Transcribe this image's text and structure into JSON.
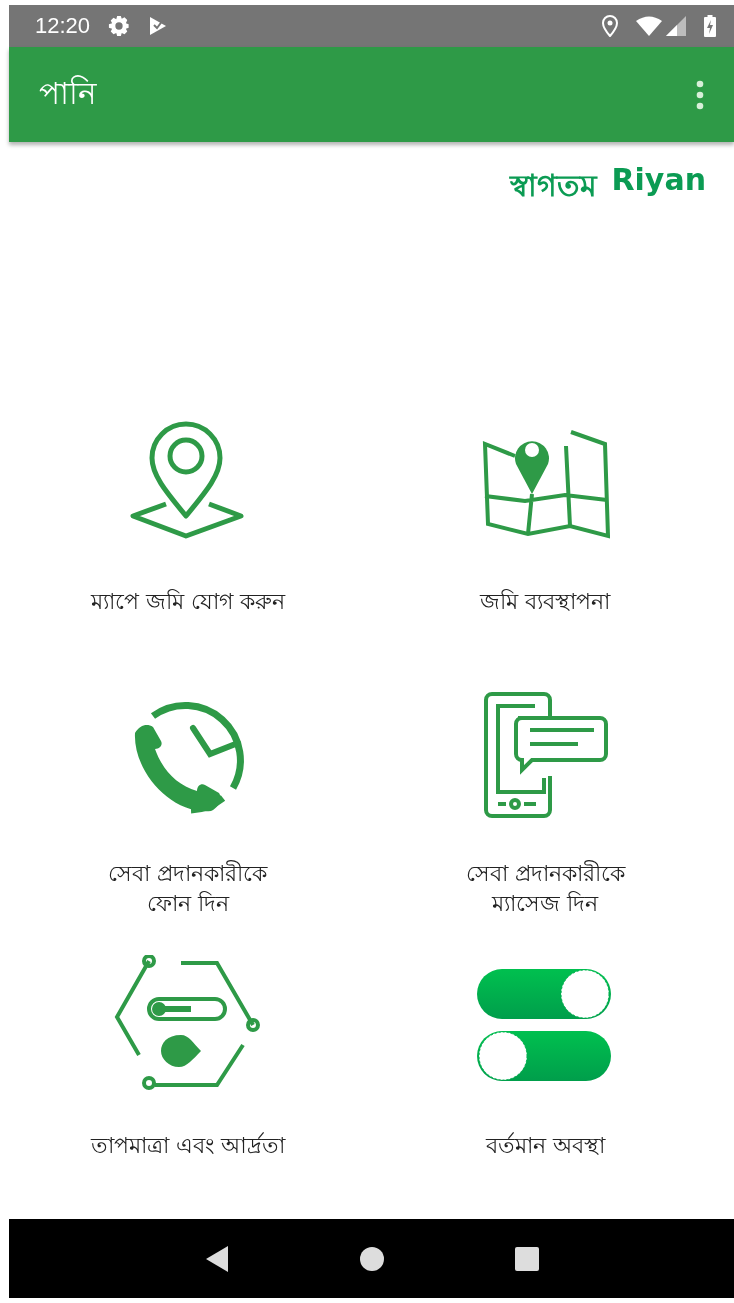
{
  "status_bar": {
    "time": "12:20"
  },
  "app_bar": {
    "title": "পানি"
  },
  "welcome": {
    "greeting": "স্বাগতম",
    "user": "Riyan"
  },
  "tiles": [
    {
      "kind": "pin",
      "label": "ম্যাপে জমি যোগ করুন"
    },
    {
      "kind": "map",
      "label": "জমি ব্যবস্থাপনা"
    },
    {
      "kind": "call",
      "label": "সেবা প্রদানকারীকে\nফোন দিন"
    },
    {
      "kind": "message",
      "label": "সেবা প্রদানকারীকে\nম্যাসেজ দিন"
    },
    {
      "kind": "sensor",
      "label": "তাপমাত্রা এবং আর্দ্রতা"
    },
    {
      "kind": "switches",
      "label": "বর্তমান অবস্থা"
    }
  ]
}
